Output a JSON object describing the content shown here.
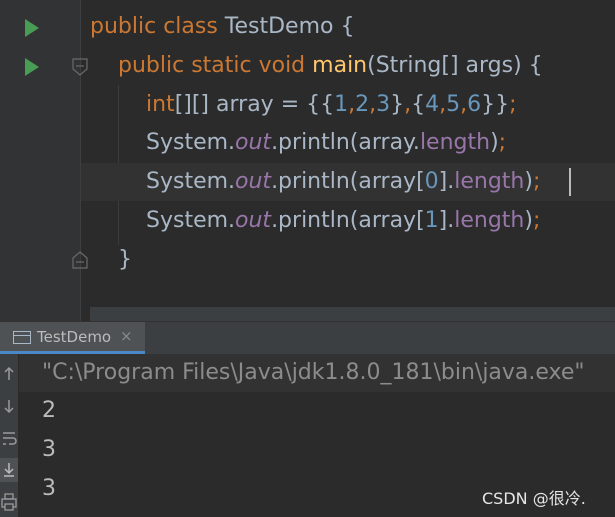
{
  "editor": {
    "lines": [
      {
        "tokens": [
          {
            "t": "public ",
            "c": "kw"
          },
          {
            "t": "class ",
            "c": "kw"
          },
          {
            "t": "TestDemo {",
            "c": ""
          }
        ]
      },
      {
        "tokens": [
          {
            "t": "public ",
            "c": "kw"
          },
          {
            "t": "static ",
            "c": "kw"
          },
          {
            "t": "void ",
            "c": "kw"
          },
          {
            "t": "main",
            "c": "fn"
          },
          {
            "t": "(String[] args) {",
            "c": ""
          }
        ]
      },
      {
        "tokens": [
          {
            "t": "int",
            "c": "kw"
          },
          {
            "t": "[][] array = {{",
            "c": ""
          },
          {
            "t": "1",
            "c": "num"
          },
          {
            "t": ",",
            "c": "kw"
          },
          {
            "t": "2",
            "c": "num"
          },
          {
            "t": ",",
            "c": "kw"
          },
          {
            "t": "3",
            "c": "num"
          },
          {
            "t": "}",
            "c": ""
          },
          {
            "t": ",",
            "c": "kw"
          },
          {
            "t": "{",
            "c": ""
          },
          {
            "t": "4",
            "c": "num"
          },
          {
            "t": ",",
            "c": "kw"
          },
          {
            "t": "5",
            "c": "num"
          },
          {
            "t": ",",
            "c": "kw"
          },
          {
            "t": "6",
            "c": "num"
          },
          {
            "t": "}}",
            "c": ""
          },
          {
            "t": ";",
            "c": "kw"
          }
        ]
      },
      {
        "tokens": [
          {
            "t": "System.",
            "c": ""
          },
          {
            "t": "out",
            "c": "sfld"
          },
          {
            "t": ".println(array.",
            "c": ""
          },
          {
            "t": "length",
            "c": "fld"
          },
          {
            "t": ")",
            "c": ""
          },
          {
            "t": ";",
            "c": "kw"
          }
        ]
      },
      {
        "tokens": [
          {
            "t": "System.",
            "c": ""
          },
          {
            "t": "out",
            "c": "sfld"
          },
          {
            "t": ".println(array[",
            "c": ""
          },
          {
            "t": "0",
            "c": "num"
          },
          {
            "t": "].",
            "c": ""
          },
          {
            "t": "length",
            "c": "fld"
          },
          {
            "t": ")",
            "c": ""
          },
          {
            "t": ";",
            "c": "kw"
          }
        ]
      },
      {
        "tokens": [
          {
            "t": "System.",
            "c": ""
          },
          {
            "t": "out",
            "c": "sfld"
          },
          {
            "t": ".println(array[",
            "c": ""
          },
          {
            "t": "1",
            "c": "num"
          },
          {
            "t": "].",
            "c": ""
          },
          {
            "t": "length",
            "c": "fld"
          },
          {
            "t": ")",
            "c": ""
          },
          {
            "t": ";",
            "c": "kw"
          }
        ]
      },
      {
        "tokens": [
          {
            "t": "}",
            "c": ""
          }
        ]
      }
    ]
  },
  "run_panel": {
    "tab_label": "TestDemo",
    "tab_close": "×",
    "command": "\"C:\\Program Files\\Java\\jdk1.8.0_181\\bin\\java.exe\"",
    "output": [
      "2",
      "3",
      "3"
    ]
  },
  "watermark": "CSDN @很冷.",
  "colors": {
    "keyword": "#cc7832",
    "function": "#ffc66d",
    "number": "#6897bb",
    "field": "#9876aa",
    "text": "#a9b7c6",
    "run_green": "#499c54",
    "tab_accent": "#4a88c7"
  },
  "icons": {
    "gutter": [
      "run-class-icon",
      "run-main-icon",
      "fold-open-icon",
      "fold-close-icon"
    ],
    "toolbar": [
      "up-arrow-icon",
      "down-arrow-icon",
      "soft-wrap-icon",
      "scroll-to-end-icon",
      "print-icon"
    ]
  }
}
